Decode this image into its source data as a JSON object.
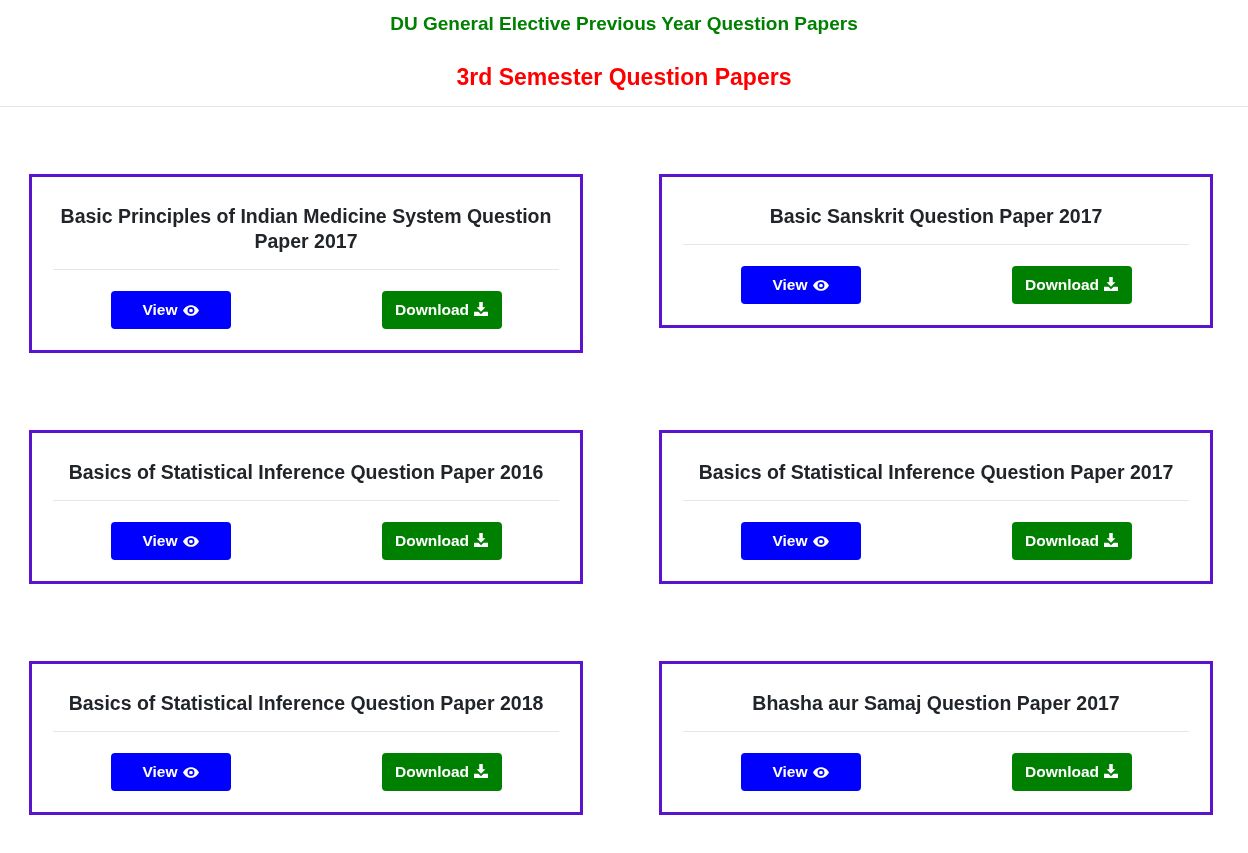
{
  "header": {
    "site_title": "DU General Elective Previous Year Question Papers",
    "page_title": "3rd Semester Question Papers"
  },
  "papers": [
    {
      "title": "Basic Principles of Indian Medicine System Question Paper 2017",
      "buttons": [
        {
          "kind": "view",
          "label": "View"
        },
        {
          "kind": "download",
          "label": "Download"
        }
      ]
    },
    {
      "title": "Basic Sanskrit Question Paper 2017",
      "buttons": [
        {
          "kind": "view",
          "label": "View"
        },
        {
          "kind": "download",
          "label": "Download"
        }
      ]
    },
    {
      "title": "Basics of Statistical Inference Question Paper 2016",
      "buttons": [
        {
          "kind": "view",
          "label": "View"
        },
        {
          "kind": "download",
          "label": "Download"
        }
      ]
    },
    {
      "title": "Basics of Statistical Inference Question Paper 2017",
      "buttons": [
        {
          "kind": "view",
          "label": "View"
        },
        {
          "kind": "download",
          "label": "Download"
        }
      ]
    },
    {
      "title": "Basics of Statistical Inference Question Paper 2018",
      "buttons": [
        {
          "kind": "view",
          "label": "View"
        },
        {
          "kind": "download",
          "label": "Download"
        }
      ]
    },
    {
      "title": "Bhasha aur Samaj Question Paper 2017",
      "buttons": [
        {
          "kind": "view",
          "label": "View"
        },
        {
          "kind": "download",
          "label": "Download"
        }
      ]
    }
  ]
}
